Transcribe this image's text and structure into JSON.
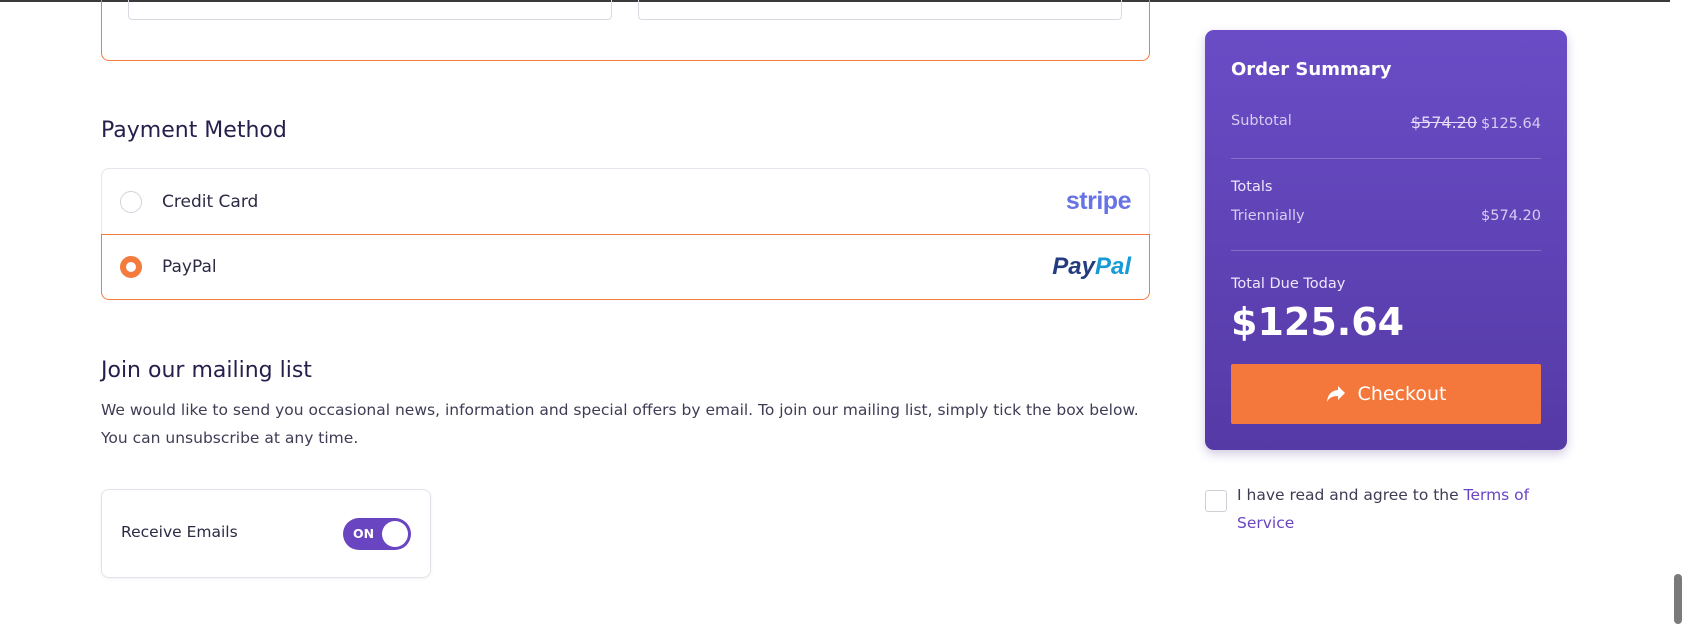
{
  "payment": {
    "title": "Payment Method",
    "options": [
      {
        "label": "Credit Card",
        "provider": "stripe",
        "selected": false
      },
      {
        "label": "PayPal",
        "provider_part1": "Pay",
        "provider_part2": "Pal",
        "selected": true
      }
    ]
  },
  "mailing": {
    "title": "Join our mailing list",
    "description": "We would like to send you occasional news, information and special offers by email. To join our mailing list, simply tick the box below. You can unsubscribe at any time.",
    "toggle_label": "Receive Emails",
    "toggle_state": "ON"
  },
  "summary": {
    "title": "Order Summary",
    "subtotal_label": "Subtotal",
    "subtotal_original": "$574.20",
    "subtotal_discounted": "$125.64",
    "totals_label": "Totals",
    "cycle_label": "Triennially",
    "cycle_value": "$574.20",
    "due_label": "Total Due Today",
    "due_value": "$125.64",
    "checkout_label": "Checkout"
  },
  "tos": {
    "text": "I have read and agree to the ",
    "link": "Terms of Service"
  },
  "colors": {
    "accent": "#f47b3e",
    "purple": "#6a45c2",
    "summary_bg": "#5f43b8"
  }
}
